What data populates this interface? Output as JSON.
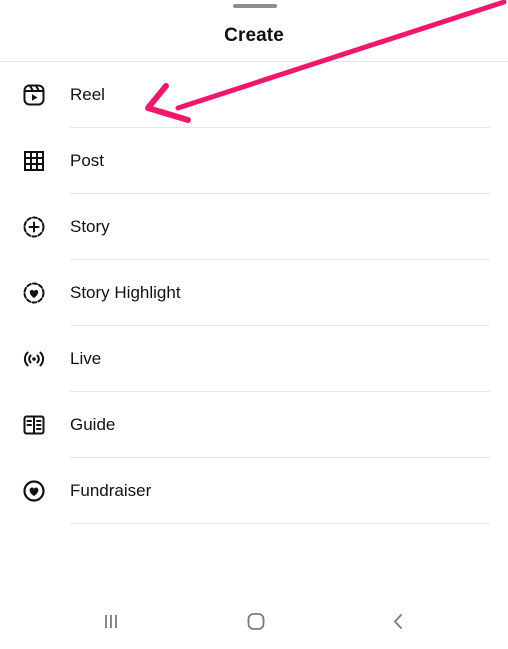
{
  "sheet": {
    "title": "Create"
  },
  "menu": {
    "items": [
      {
        "key": "reel",
        "label": "Reel",
        "icon": "reel-icon"
      },
      {
        "key": "post",
        "label": "Post",
        "icon": "grid-icon"
      },
      {
        "key": "story",
        "label": "Story",
        "icon": "story-add-icon"
      },
      {
        "key": "story-highlight",
        "label": "Story Highlight",
        "icon": "story-highlight-icon"
      },
      {
        "key": "live",
        "label": "Live",
        "icon": "live-icon"
      },
      {
        "key": "guide",
        "label": "Guide",
        "icon": "guide-book-icon"
      },
      {
        "key": "fundraiser",
        "label": "Fundraiser",
        "icon": "fundraiser-heart-icon"
      }
    ]
  },
  "navbar": {
    "buttons": [
      "recent-apps-icon",
      "home-icon",
      "back-icon"
    ]
  },
  "colors": {
    "annotation_arrow": "#f0186c",
    "text": "#111111",
    "divider": "#e4e4e4",
    "nav_icon": "#7a7a7a"
  }
}
